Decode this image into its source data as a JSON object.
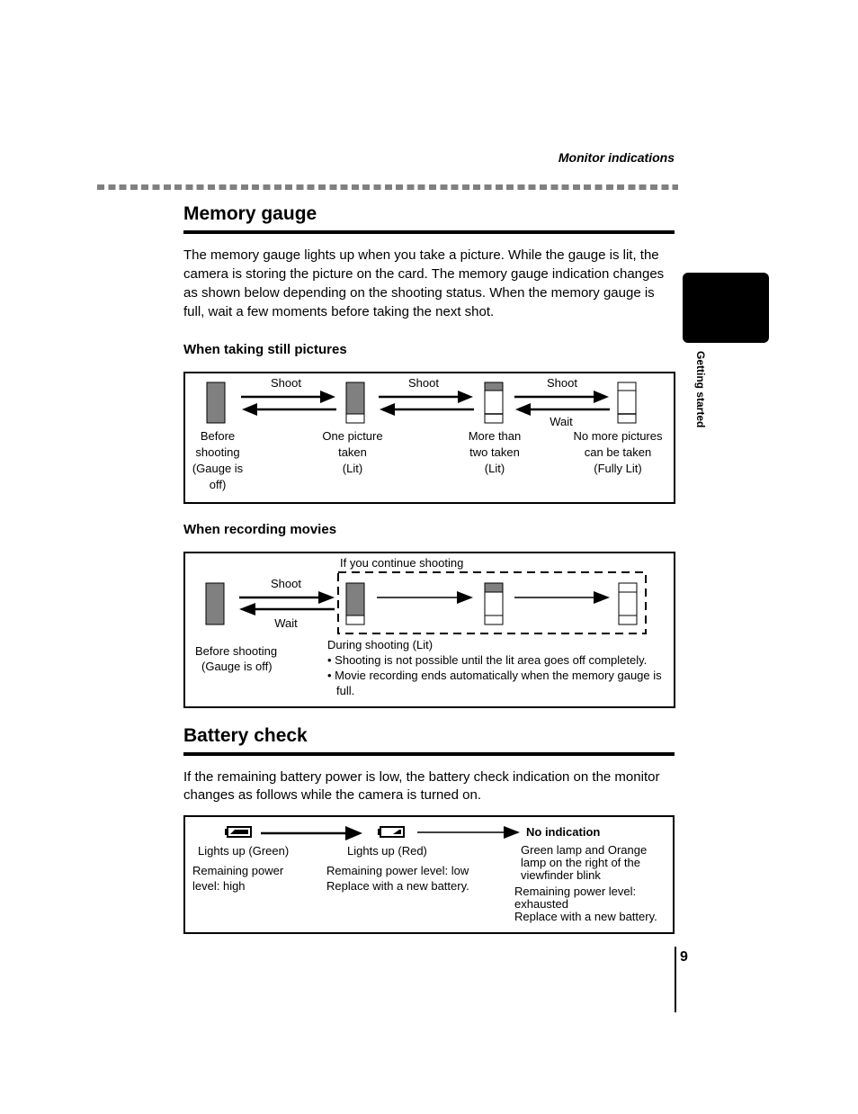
{
  "header": {
    "title": "Monitor indications"
  },
  "side_tab": {
    "label": "Getting started"
  },
  "page_number": "9",
  "memory_gauge": {
    "heading": "Memory gauge",
    "intro": "The memory gauge lights up when you take a picture. While the gauge is lit, the camera is storing the picture on the card. The memory gauge indication changes as shown below depending on the shooting status. When the memory gauge is full, wait a few moments before taking the next shot.",
    "still": {
      "heading": "When taking still pictures",
      "arrow_labels": [
        "Shoot",
        "Shoot",
        "Shoot",
        "Wait"
      ],
      "states": [
        {
          "label_lines": [
            "Before",
            "shooting",
            "(Gauge is",
            "off)"
          ],
          "gauge": "off"
        },
        {
          "label_lines": [
            "One picture",
            "taken",
            "(Lit)"
          ],
          "gauge": "one"
        },
        {
          "label_lines": [
            "More than",
            "two taken",
            "(Lit)"
          ],
          "gauge": "two"
        },
        {
          "label_lines": [
            "No more pictures",
            "can be taken",
            "(Fully Lit)"
          ],
          "gauge": "full"
        }
      ]
    },
    "movies": {
      "heading": "When recording movies",
      "continue_label": "If you continue shooting",
      "shoot_label": "Shoot",
      "wait_label": "Wait",
      "before_lines": [
        "Before shooting",
        "(Gauge is off)"
      ],
      "during_title": "During shooting (Lit)",
      "bullets": [
        "Shooting is not possible until the lit area goes off completely.",
        "Movie recording ends automatically when the memory gauge is full."
      ],
      "bullet_line_2": "is full.",
      "bullet_line_1b": "Movie recording ends automatically when the memory gauge"
    }
  },
  "battery_check": {
    "heading": "Battery check",
    "intro": "If the remaining battery power is low, the battery check indication on the monitor changes as follows while the camera is turned on.",
    "states": [
      {
        "icon": "battery-full-icon",
        "status": "Lights up (Green)",
        "desc_lines": [
          "Remaining power",
          "level: high"
        ]
      },
      {
        "icon": "battery-low-icon",
        "status": "Lights up (Red)",
        "desc_lines": [
          "Remaining power level: low",
          "Replace with a new battery."
        ]
      },
      {
        "icon": "none",
        "status": "No indication",
        "lamp_lines": [
          "Green lamp and Orange",
          "lamp on the right of the",
          "viewfinder blink"
        ],
        "desc_lines": [
          "Remaining power level:",
          "exhausted",
          "Replace with a new battery."
        ]
      }
    ]
  }
}
